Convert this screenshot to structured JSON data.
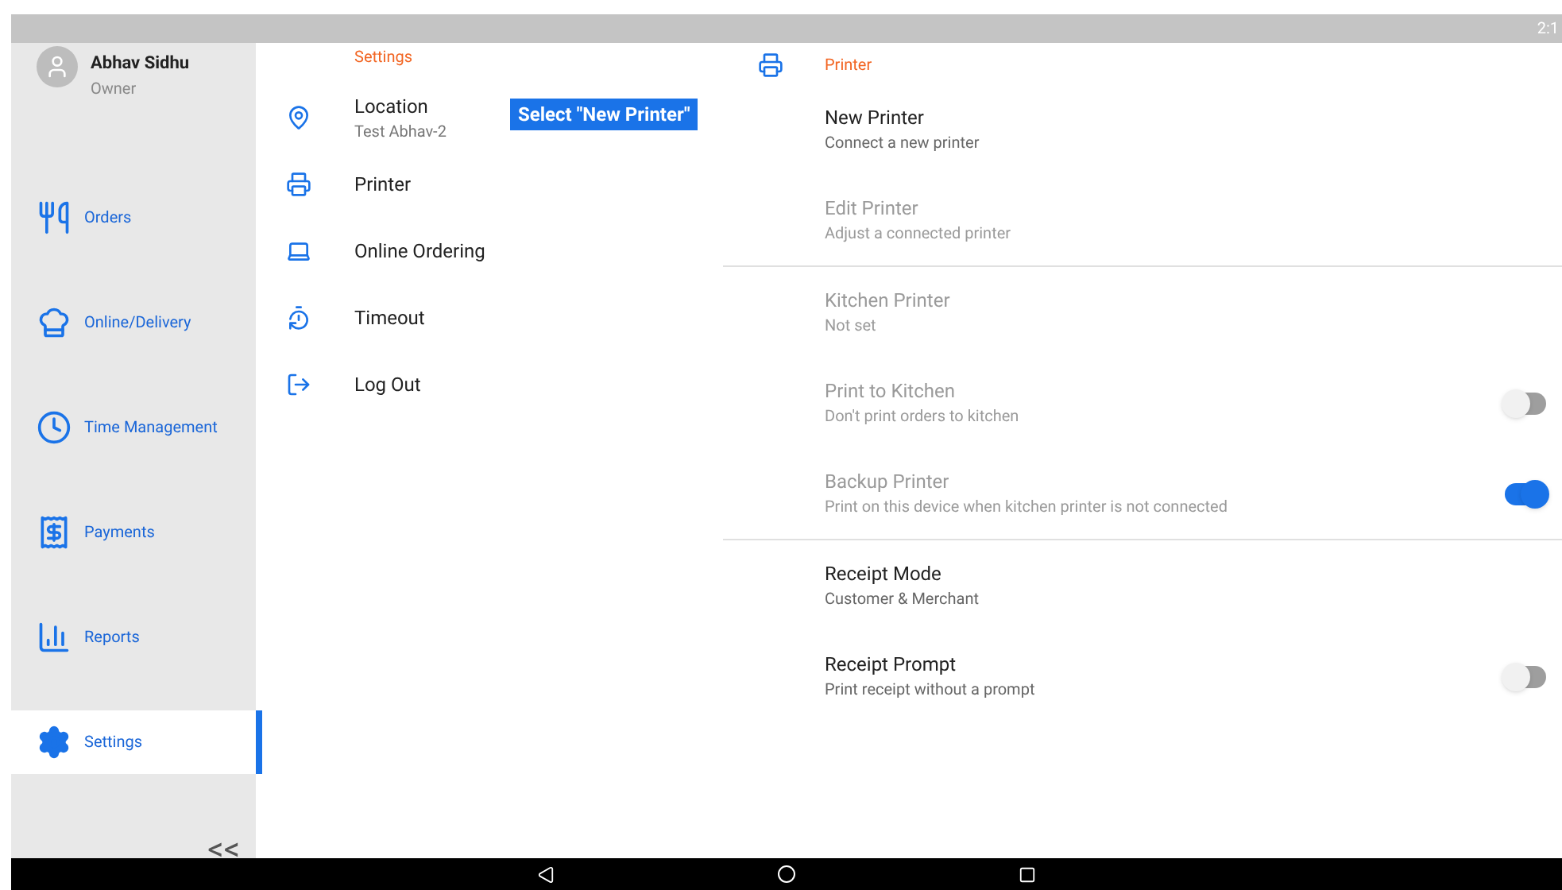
{
  "status_bar": {
    "time": "2:1"
  },
  "profile": {
    "name": "Abhav Sidhu",
    "role": "Owner"
  },
  "sidebar": {
    "items": [
      {
        "kind": "orders",
        "label": "Orders",
        "selected": false
      },
      {
        "kind": "delivery",
        "label": "Online/Delivery",
        "selected": false
      },
      {
        "kind": "time",
        "label": "Time Management",
        "selected": false
      },
      {
        "kind": "payments",
        "label": "Payments",
        "selected": false
      },
      {
        "kind": "reports",
        "label": "Reports",
        "selected": false
      },
      {
        "kind": "settings",
        "label": "Settings",
        "selected": true
      }
    ],
    "collapse": "<<"
  },
  "settings_menu": {
    "title": "Settings",
    "items": [
      {
        "kind": "location",
        "label": "Location",
        "sublabel": "Test Abhav-2"
      },
      {
        "kind": "printer",
        "label": "Printer"
      },
      {
        "kind": "online",
        "label": "Online Ordering"
      },
      {
        "kind": "timeout",
        "label": "Timeout"
      },
      {
        "kind": "logout",
        "label": "Log Out"
      }
    ]
  },
  "tooltip": "Select \"New Printer\"",
  "printer_panel": {
    "title": "Printer",
    "items": [
      {
        "kind": "link",
        "label": "New Printer",
        "sublabel": "Connect a new printer",
        "disabled": false
      },
      {
        "kind": "link",
        "label": "Edit Printer",
        "sublabel": "Adjust a connected printer",
        "disabled": true,
        "divider_after": true
      },
      {
        "kind": "link",
        "label": "Kitchen Printer",
        "sublabel": "Not set",
        "disabled": true
      },
      {
        "kind": "toggle",
        "label": "Print to Kitchen",
        "sublabel": "Don't print orders to kitchen",
        "disabled": true,
        "on": false
      },
      {
        "kind": "toggle",
        "label": "Backup Printer",
        "sublabel": "Print on this device when kitchen printer is not connected",
        "disabled": true,
        "on": true,
        "divider_after": true
      },
      {
        "kind": "link",
        "label": "Receipt Mode",
        "sublabel": "Customer & Merchant",
        "disabled": false
      },
      {
        "kind": "toggle",
        "label": "Receipt Prompt",
        "sublabel": "Print receipt without a prompt",
        "disabled": false,
        "on": false
      }
    ]
  }
}
